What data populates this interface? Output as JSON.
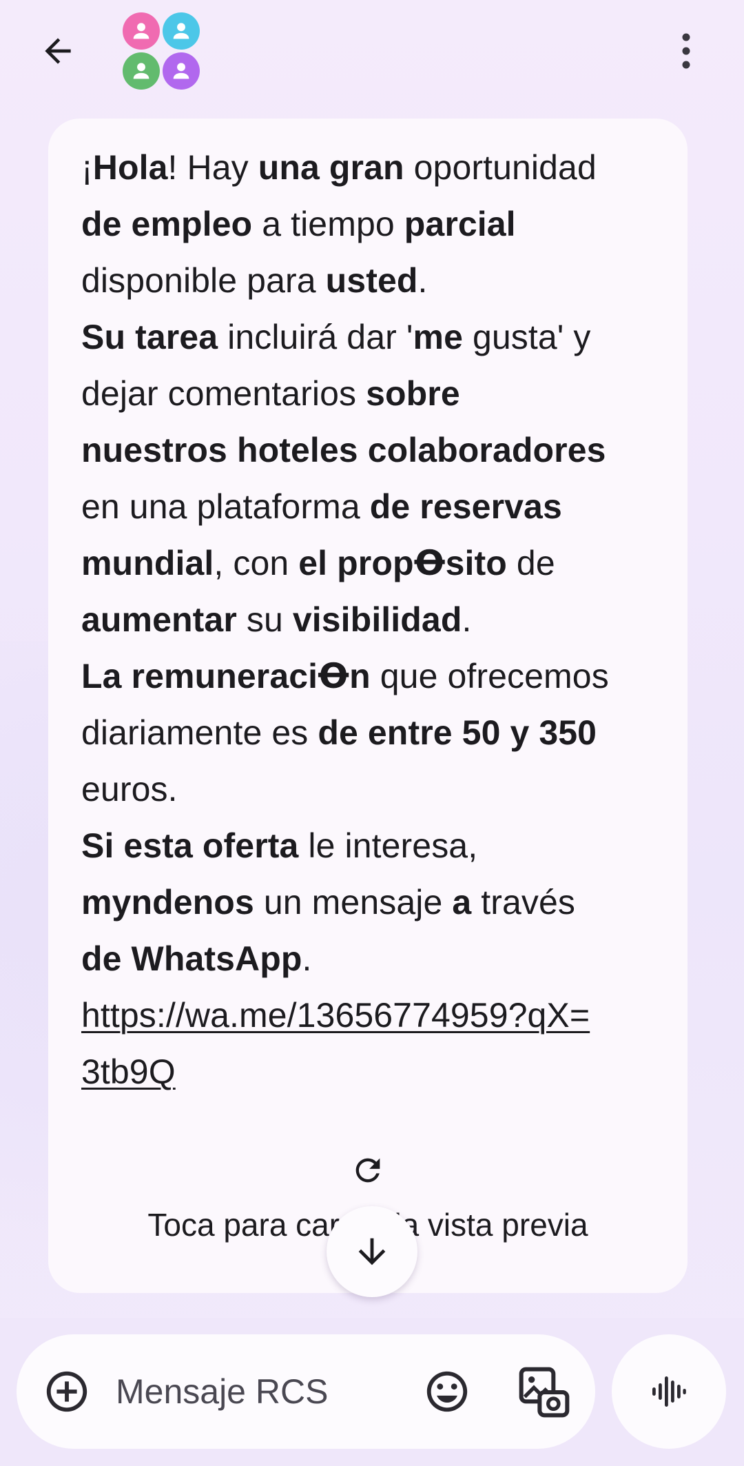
{
  "header": {
    "back_icon": "arrow-back-icon",
    "avatar_icon": "group-avatar-icon",
    "avatar_colors": [
      "#f06bb1",
      "#4cc7e8",
      "#62bb6e",
      "#b168ee"
    ],
    "menu_icon": "more-vert-icon"
  },
  "message": {
    "lines": [
      [
        {
          "t": "¡",
          "b": false
        },
        {
          "t": "Hola",
          "b": true
        },
        {
          "t": "! Hay ",
          "b": false
        },
        {
          "t": "una gran",
          "b": true
        },
        {
          "t": " oportunidad",
          "b": false
        }
      ],
      [
        {
          "t": "de empleo",
          "b": true
        },
        {
          "t": " a tiempo ",
          "b": false
        },
        {
          "t": "parcial",
          "b": true
        }
      ],
      [
        {
          "t": "disponible para ",
          "b": false
        },
        {
          "t": "usted",
          "b": true
        },
        {
          "t": ".",
          "b": false
        }
      ],
      [
        {
          "t": "Su tarea",
          "b": true
        },
        {
          "t": " incluirá dar '",
          "b": false
        },
        {
          "t": "me",
          "b": true
        },
        {
          "t": " gusta' y",
          "b": false
        }
      ],
      [
        {
          "t": "dejar comentarios ",
          "b": false
        },
        {
          "t": "sobre",
          "b": true
        }
      ],
      [
        {
          "t": "nuestros hoteles colaboradores",
          "b": true
        }
      ],
      [
        {
          "t": "en una plataforma ",
          "b": false
        },
        {
          "t": "de reservas",
          "b": true
        }
      ],
      [
        {
          "t": "mundial",
          "b": true
        },
        {
          "t": ", con ",
          "b": false
        },
        {
          "t": "el propꝊsito",
          "b": true
        },
        {
          "t": " de",
          "b": false
        }
      ],
      [
        {
          "t": "aumentar",
          "b": true
        },
        {
          "t": " su ",
          "b": false
        },
        {
          "t": "visibilidad",
          "b": true
        },
        {
          "t": ".",
          "b": false
        }
      ],
      [
        {
          "t": "La remuneraciꝊn",
          "b": true
        },
        {
          "t": " que ofrecemos",
          "b": false
        }
      ],
      [
        {
          "t": "diariamente es ",
          "b": false
        },
        {
          "t": "de entre 50 y 350",
          "b": true
        }
      ],
      [
        {
          "t": "euros.",
          "b": false
        }
      ],
      [
        {
          "t": "Si esta oferta",
          "b": true
        },
        {
          "t": " le interesa,",
          "b": false
        }
      ],
      [
        {
          "t": "myndenos",
          "b": true
        },
        {
          "t": " un mensaje ",
          "b": false
        },
        {
          "t": "a",
          "b": true
        },
        {
          "t": " través",
          "b": false
        }
      ],
      [
        {
          "t": "de WhatsApp",
          "b": true
        },
        {
          "t": ".",
          "b": false
        }
      ]
    ],
    "link_lines": [
      "https://wa.me/13656774959?qX=",
      "3tb9Q"
    ],
    "preview_text": "Toca para cargar la vista previa",
    "refresh_icon": "refresh-icon"
  },
  "scroll_down_icon": "arrow-down-icon",
  "compose": {
    "placeholder": "Mensaje RCS",
    "value": "",
    "add_icon": "add-circle-icon",
    "emoji_icon": "emoji-icon",
    "gallery_icon": "gallery-icon",
    "voice_icon": "voice-waveform-icon"
  },
  "colors": {
    "background": "#f1e8fb",
    "bubble": "#fcf8fd",
    "text": "#1c1b1f"
  }
}
